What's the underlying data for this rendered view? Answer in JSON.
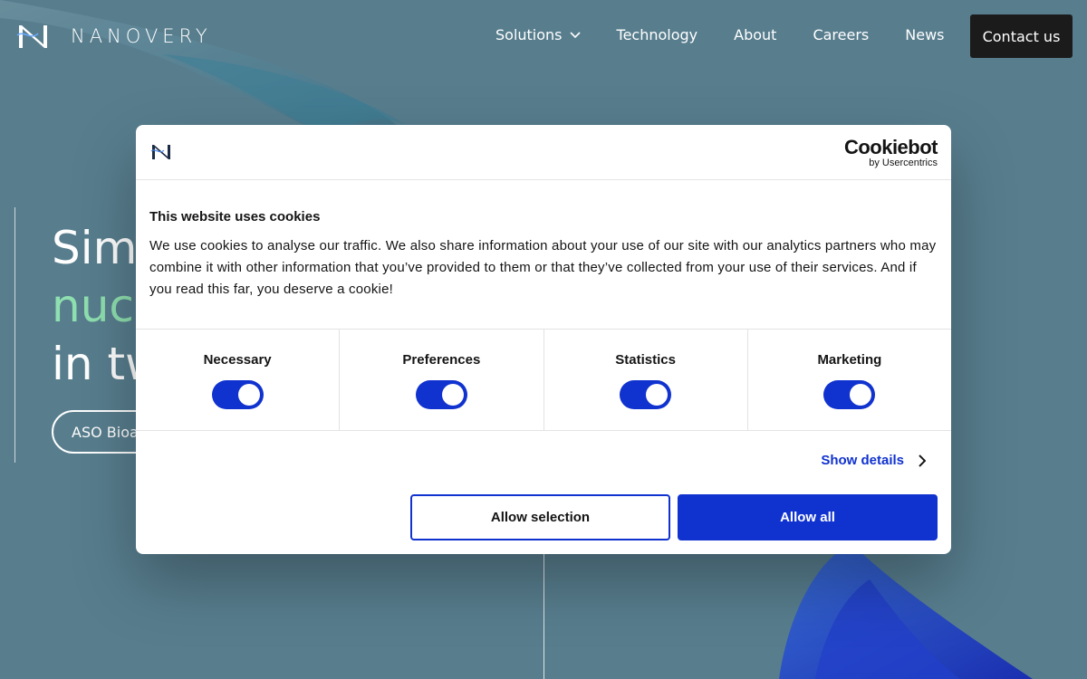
{
  "brand": {
    "name": "NANOVERY",
    "logo_icon": "nanovery-n-logo"
  },
  "nav": {
    "items": [
      {
        "label": "Solutions",
        "has_dropdown": true
      },
      {
        "label": "Technology"
      },
      {
        "label": "About"
      },
      {
        "label": "Careers"
      },
      {
        "label": "News"
      }
    ],
    "contact_label": "Contact us"
  },
  "hero": {
    "line1": "Simp",
    "line2": "nucl",
    "line3": "in tw",
    "button_label": "ASO Bioan"
  },
  "cookie_dialog": {
    "provider_name": "Cookiebot",
    "provider_by": "by Usercentrics",
    "title": "This website uses cookies",
    "text": "We use cookies to analyse our traffic. We also share information about your use of our site with our analytics partners who may combine it with other information that you’ve provided to them or that they’ve collected from your use of their services. And if you read this far, you deserve a cookie!",
    "categories": [
      {
        "label": "Necessary",
        "enabled": true
      },
      {
        "label": "Preferences",
        "enabled": true
      },
      {
        "label": "Statistics",
        "enabled": true
      },
      {
        "label": "Marketing",
        "enabled": true
      }
    ],
    "show_details_label": "Show details",
    "allow_selection_label": "Allow selection",
    "allow_all_label": "Allow all"
  },
  "colors": {
    "background": "#587e8e",
    "accent_green": "#8fe0b0",
    "cookie_blue": "#1032cf",
    "contact_button": "#1b1b1b"
  }
}
